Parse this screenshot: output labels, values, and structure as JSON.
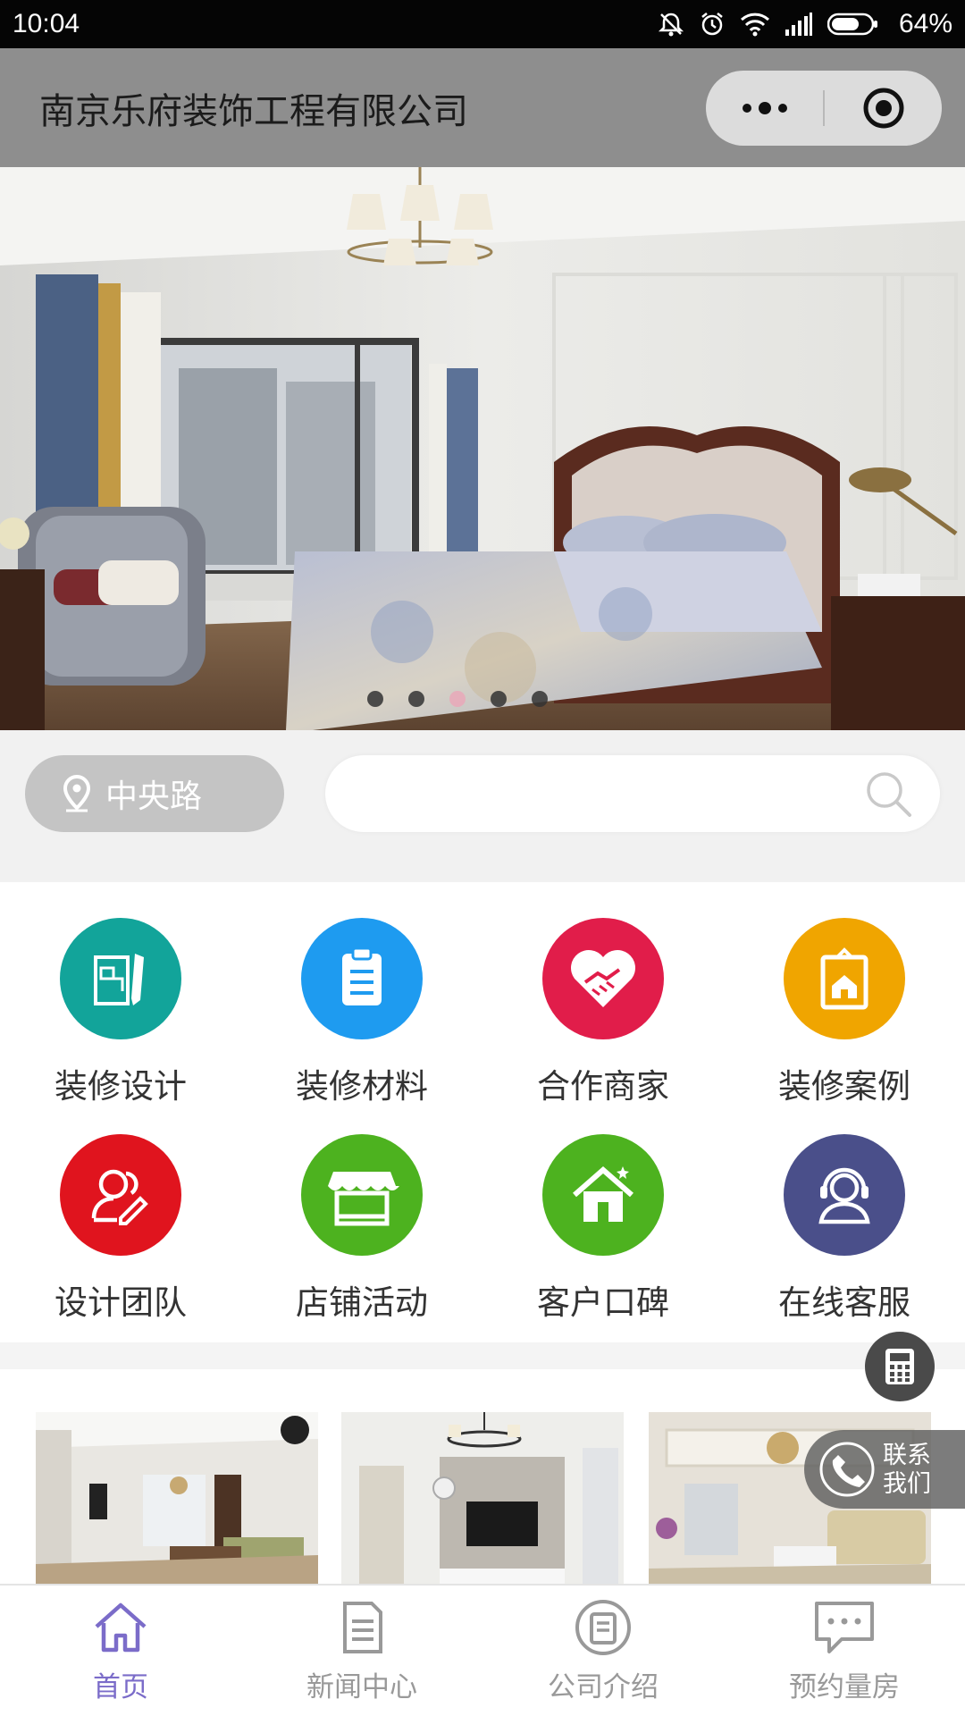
{
  "status_bar": {
    "time": "10:04",
    "battery": "64%",
    "icons": [
      "mute-icon",
      "alarm-icon",
      "wifi-icon",
      "signal-icon",
      "battery-icon"
    ]
  },
  "nav": {
    "title": "南京乐府装饰工程有限公司",
    "more_icon": "more-dots-icon",
    "close_icon": "target-close-icon"
  },
  "banner": {
    "slide_count": 5,
    "active_index": 2,
    "description_icon": "bedroom-photo"
  },
  "location": {
    "label": "中央路",
    "icon": "location-pin-icon"
  },
  "search": {
    "placeholder": "",
    "value": ""
  },
  "categories": [
    {
      "label": "装修设计",
      "icon": "blueprint-icon",
      "color": "#12a49a"
    },
    {
      "label": "装修材料",
      "icon": "clipboard-icon",
      "color": "#1e9bf0"
    },
    {
      "label": "合作商家",
      "icon": "handshake-heart-icon",
      "color": "#e11d4a"
    },
    {
      "label": "装修案例",
      "icon": "frame-house-icon",
      "color": "#f0a500"
    },
    {
      "label": "设计团队",
      "icon": "team-pen-icon",
      "color": "#e0141e"
    },
    {
      "label": "店铺活动",
      "icon": "store-icon",
      "color": "#4db21f"
    },
    {
      "label": "客户口碑",
      "icon": "house-star-icon",
      "color": "#4db21f"
    },
    {
      "label": "在线客服",
      "icon": "headset-agent-icon",
      "color": "#4a4f8a"
    }
  ],
  "floating": {
    "calculator_icon": "calculator-icon",
    "contact_label": "联系我们",
    "contact_icon": "phone-icon"
  },
  "tabs": [
    {
      "label": "首页",
      "icon": "home-icon",
      "active": true
    },
    {
      "label": "新闻中心",
      "icon": "news-icon",
      "active": false
    },
    {
      "label": "公司介绍",
      "icon": "company-icon",
      "active": false
    },
    {
      "label": "预约量房",
      "icon": "chat-bubble-icon",
      "active": false
    }
  ],
  "colors": {
    "accent": "#7b6cc9",
    "nav_bg": "#8e8e8e",
    "tab_inactive": "#999999"
  }
}
